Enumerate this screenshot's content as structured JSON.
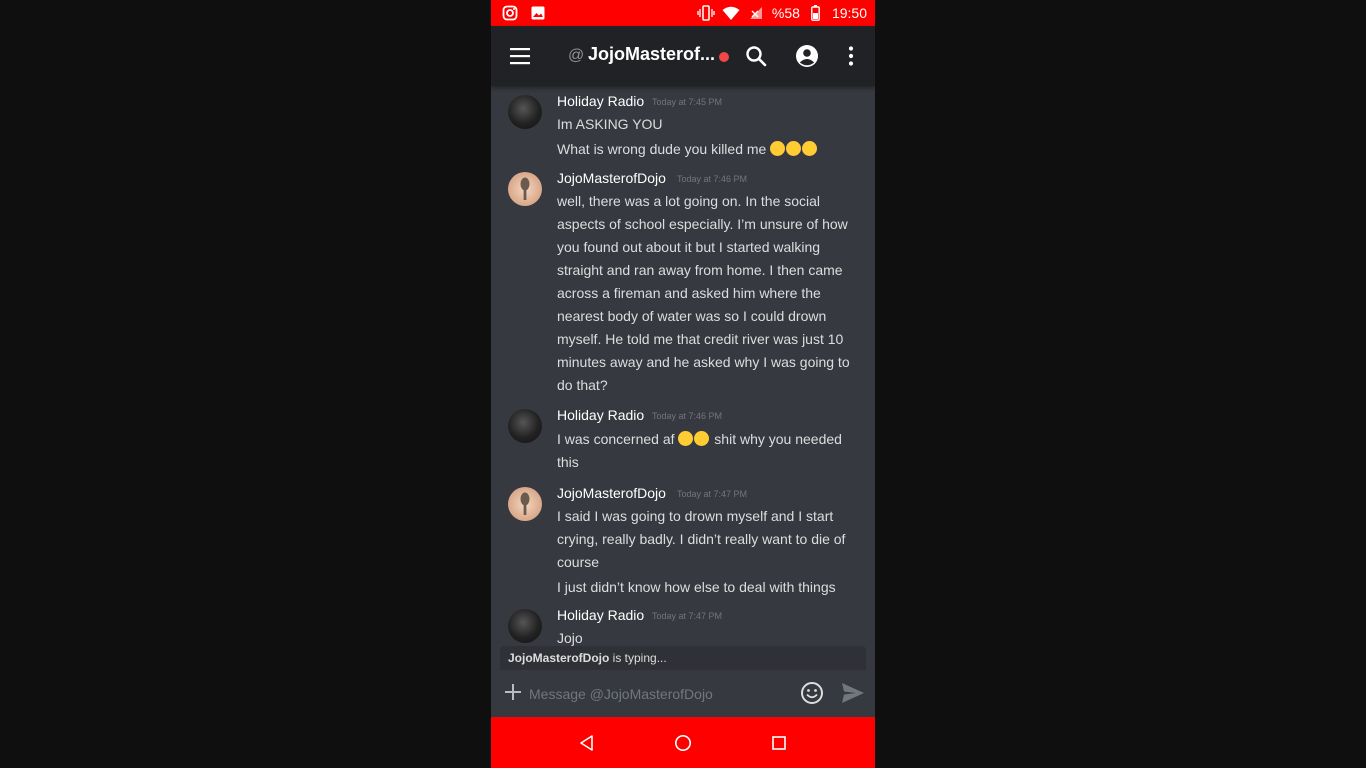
{
  "status_bar": {
    "battery": "%58",
    "time": "19:50"
  },
  "header": {
    "at_symbol": "@",
    "title": "JojoMasterof..."
  },
  "messages": [
    {
      "author": "Holiday Radio",
      "timestamp": "Today at 7:45 PM",
      "lines": [
        "Im ASKING YOU",
        "What is wrong dude you killed me"
      ],
      "emoji": "crying-face"
    },
    {
      "author": "JojoMasterofDojo",
      "timestamp": "Today at 7:46 PM",
      "lines": [
        "well, there was a lot going on. In the social",
        "aspects of school especially. I’m unsure of how",
        "you found out about it but I started walking",
        "straight and ran away from home. I then came",
        "across a fireman and asked him where the",
        "nearest body of water was so I could drown",
        "myself. He told me that credit river was just 10",
        "minutes away and he asked why I was going to",
        "do that?"
      ]
    },
    {
      "author": "Holiday Radio",
      "timestamp": "Today at 7:46 PM",
      "lines": [
        "I was concerned af",
        "shit why you needed",
        "this"
      ],
      "emoji": "confounded-face"
    },
    {
      "author": "JojoMasterofDojo",
      "timestamp": "Today at 7:47 PM",
      "lines": [
        "I said I was going to drown myself and I start",
        "crying, really badly. I didn’t really want to die of",
        "course",
        "I just didn’t know how else to deal with things"
      ]
    },
    {
      "author": "Holiday Radio",
      "timestamp": "Today at 7:47 PM",
      "lines": [
        "Jojo"
      ]
    }
  ],
  "typing": {
    "user": "JojoMasterofDojo",
    "suffix": " is typing..."
  },
  "composer": {
    "placeholder": "Message @JojoMasterofDojo"
  },
  "colors": {
    "status_bar": "#ff0000",
    "nav_bar": "#ff0000",
    "app_bar": "#202225",
    "chat_bg": "#36393f",
    "unread_dot": "#f04747"
  },
  "icons": {
    "status_left": [
      "instagram-icon",
      "image-icon"
    ],
    "status_right": [
      "vibrate-icon",
      "wifi-icon",
      "signal-icon",
      "battery-icon"
    ],
    "app_bar": [
      "menu-icon",
      "search-icon",
      "account-icon",
      "more-vert-icon"
    ],
    "composer": [
      "plus-icon",
      "emoji-icon",
      "send-icon"
    ],
    "nav": [
      "back-icon",
      "home-icon",
      "recents-icon"
    ]
  }
}
